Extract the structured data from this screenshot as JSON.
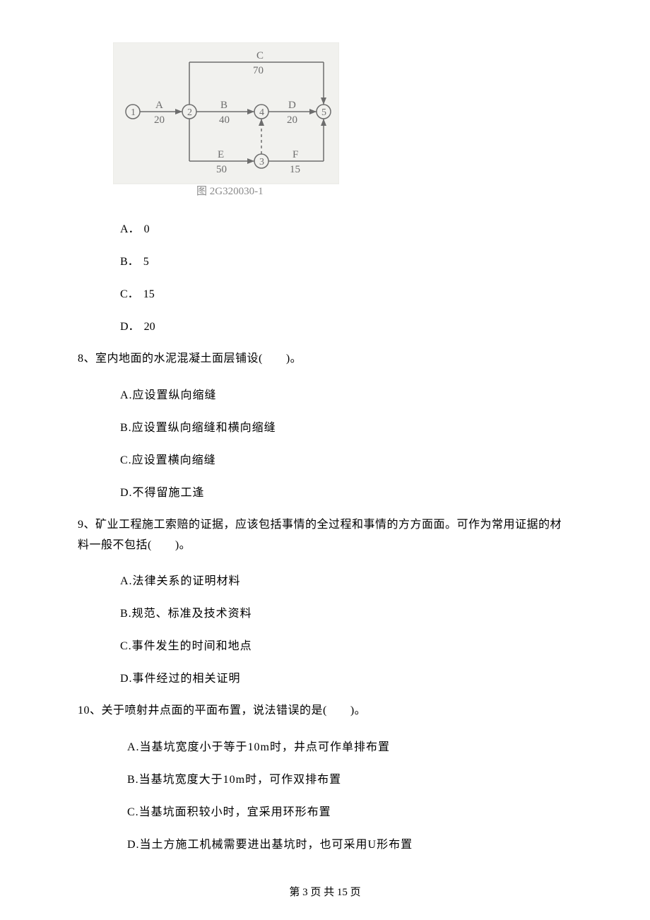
{
  "diagram": {
    "nodes": [
      "1",
      "2",
      "3",
      "4",
      "5"
    ],
    "edges": {
      "A": {
        "label": "A",
        "value": "20"
      },
      "B": {
        "label": "B",
        "value": "40"
      },
      "C": {
        "label": "C",
        "value": "70"
      },
      "D": {
        "label": "D",
        "value": "20"
      },
      "E": {
        "label": "E",
        "value": "50"
      },
      "F": {
        "label": "F",
        "value": "15"
      }
    },
    "caption": "图 2G320030-1"
  },
  "q7_options": {
    "A": {
      "label": "A．",
      "value": "0"
    },
    "B": {
      "label": "B．",
      "value": "5"
    },
    "C": {
      "label": "C．",
      "value": "15"
    },
    "D": {
      "label": "D．",
      "value": "20"
    }
  },
  "q8": {
    "text": "8、室内地面的水泥混凝土面层铺设(　　)。",
    "options": {
      "A": "A.应设置纵向缩缝",
      "B": "B.应设置纵向缩缝和横向缩缝",
      "C": "C.应设置横向缩缝",
      "D": "D.不得留施工逢"
    }
  },
  "q9": {
    "text": "9、矿业工程施工索赔的证据，应该包括事情的全过程和事情的方方面面。可作为常用证据的材料一般不包括(　　)。",
    "options": {
      "A": "A.法律关系的证明材料",
      "B": "B.规范、标准及技术资料",
      "C": "C.事件发生的时间和地点",
      "D": "D.事件经过的相关证明"
    }
  },
  "q10": {
    "text": "10、关于喷射井点面的平面布置，说法错误的是(　　)。",
    "options": {
      "A": "A.当基坑宽度小于等于10m时，井点可作单排布置",
      "B": "B.当基坑宽度大于10m时，可作双排布置",
      "C": "C.当基坑面积较小时，宜采用环形布置",
      "D": "D.当土方施工机械需要进出基坑时，也可采用U形布置"
    }
  },
  "footer": "第 3 页 共 15 页"
}
